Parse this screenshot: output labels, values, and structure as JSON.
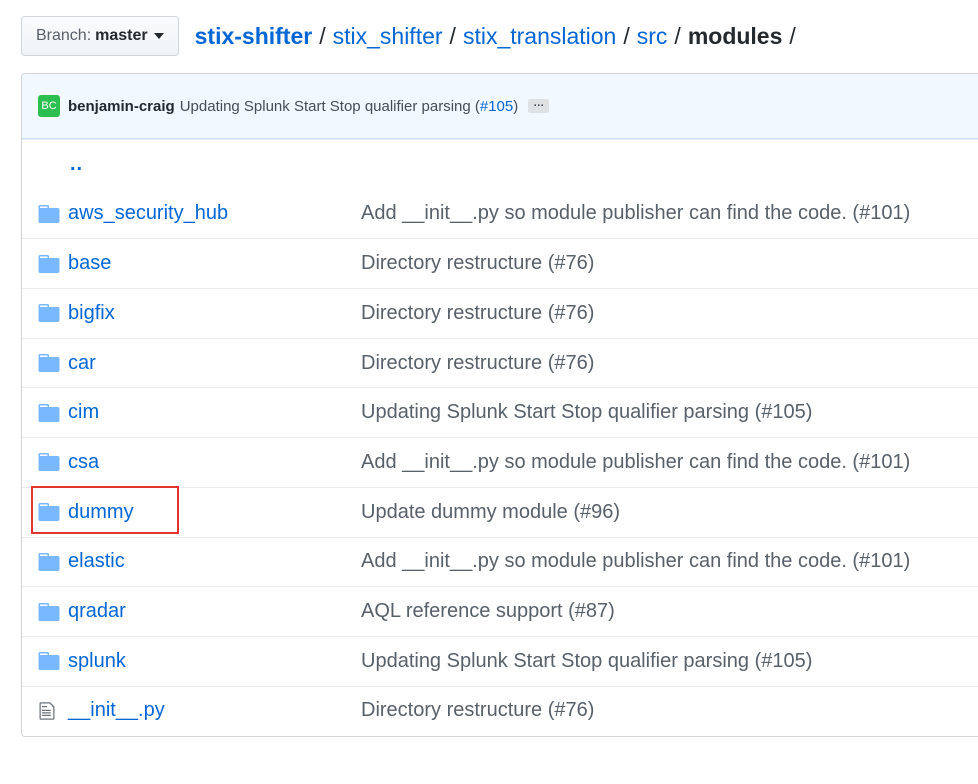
{
  "branch": {
    "prefix": "Branch:",
    "name": "master"
  },
  "breadcrumb": {
    "repo": "stix-shifter",
    "parts": [
      "stix_shifter",
      "stix_translation",
      "src"
    ],
    "current": "modules",
    "separator": "/"
  },
  "commit": {
    "avatar_initials": "BC",
    "author": "benjamin-craig",
    "message": "Updating Splunk Start Stop qualifier parsing (",
    "pr": "#105",
    "message_end": ")",
    "ellipsis": "…"
  },
  "parent_link": "..",
  "files": [
    {
      "type": "folder",
      "name": "aws_security_hub",
      "message": "Add __init__.py so module publisher can find the code. (#101)"
    },
    {
      "type": "folder",
      "name": "base",
      "message": "Directory restructure (#76)"
    },
    {
      "type": "folder",
      "name": "bigfix",
      "message": "Directory restructure (#76)"
    },
    {
      "type": "folder",
      "name": "car",
      "message": "Directory restructure (#76)"
    },
    {
      "type": "folder",
      "name": "cim",
      "message": "Updating Splunk Start Stop qualifier parsing (#105)"
    },
    {
      "type": "folder",
      "name": "csa",
      "message": "Add __init__.py so module publisher can find the code. (#101)"
    },
    {
      "type": "folder",
      "name": "dummy",
      "message": "Update dummy module (#96)"
    },
    {
      "type": "folder",
      "name": "elastic",
      "message": "Add __init__.py so module publisher can find the code. (#101)"
    },
    {
      "type": "folder",
      "name": "qradar",
      "message": "AQL reference support (#87)"
    },
    {
      "type": "folder",
      "name": "splunk",
      "message": "Updating Splunk Start Stop qualifier parsing (#105)"
    },
    {
      "type": "file",
      "name": "__init__.py",
      "message": "Directory restructure (#76)"
    }
  ],
  "colors": {
    "link": "#0366d6",
    "folder_icon": "#79b8ff",
    "commit_bar_bg": "#f1f8ff",
    "highlight": "#e3342f"
  }
}
